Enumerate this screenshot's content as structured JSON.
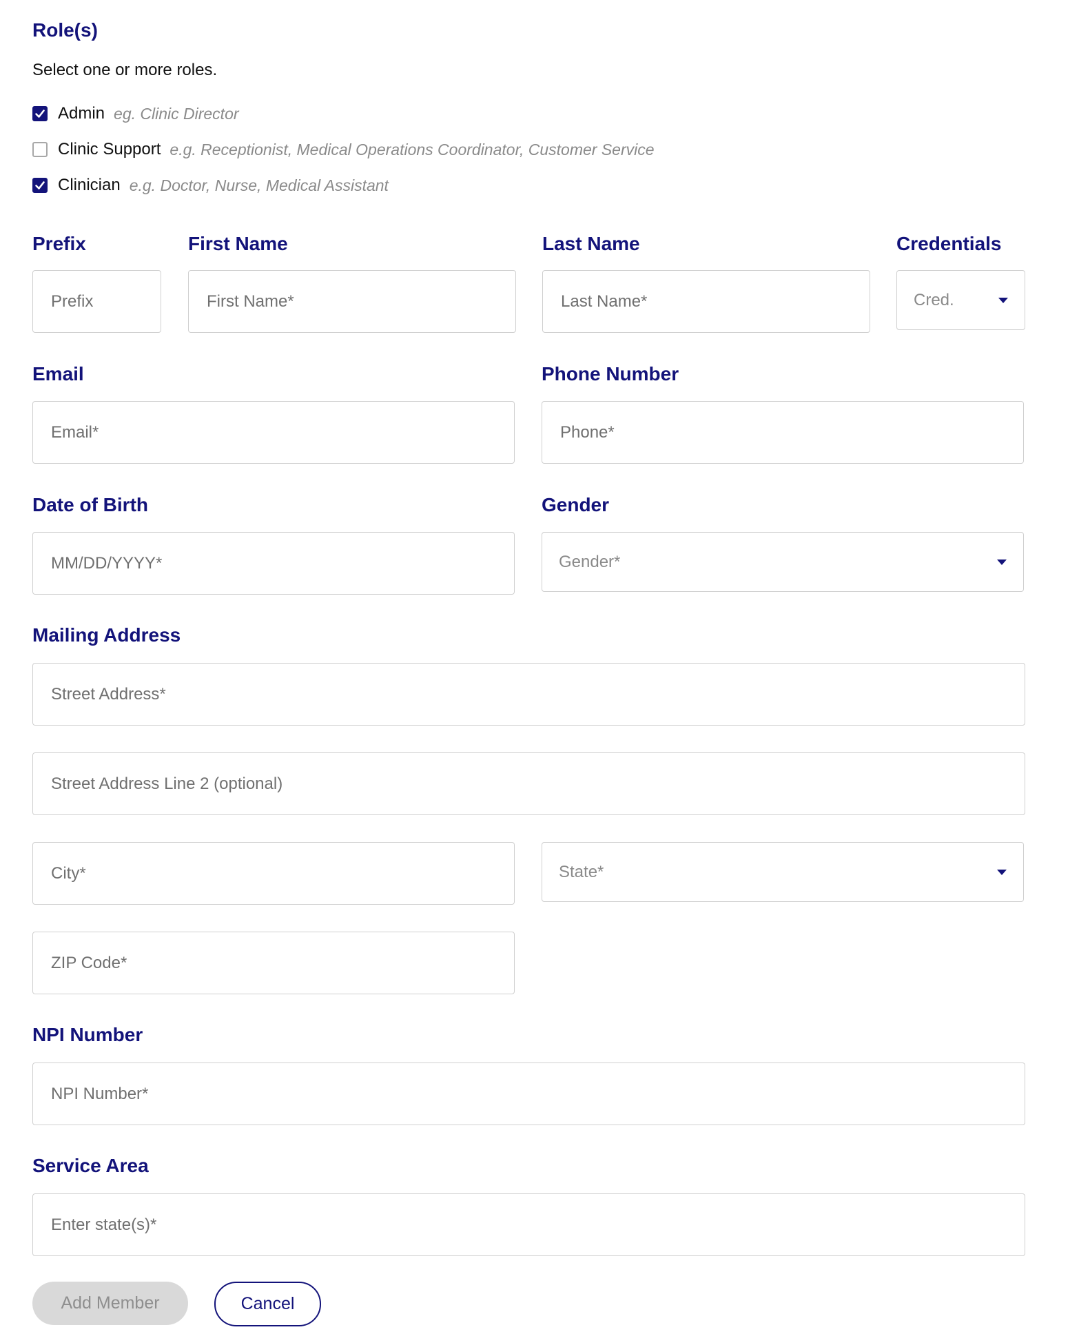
{
  "roles": {
    "heading": "Role(s)",
    "instruction": "Select one or more roles.",
    "options": [
      {
        "label": "Admin",
        "example": "eg. Clinic Director",
        "checked": true
      },
      {
        "label": "Clinic Support",
        "example": "e.g. Receptionist, Medical Operations Coordinator, Customer Service",
        "checked": false
      },
      {
        "label": "Clinician",
        "example": "e.g. Doctor, Nurse, Medical Assistant",
        "checked": true
      }
    ]
  },
  "name": {
    "prefix": {
      "heading": "Prefix",
      "placeholder": "Prefix"
    },
    "first": {
      "heading": "First Name",
      "placeholder": "First Name*"
    },
    "last": {
      "heading": "Last Name",
      "placeholder": "Last Name*"
    },
    "credentials": {
      "heading": "Credentials",
      "placeholder": "Cred."
    }
  },
  "contact": {
    "email": {
      "heading": "Email",
      "placeholder": "Email*"
    },
    "phone": {
      "heading": "Phone Number",
      "placeholder": "Phone*"
    }
  },
  "personal": {
    "dob": {
      "heading": "Date of Birth",
      "placeholder": "MM/DD/YYYY*"
    },
    "gender": {
      "heading": "Gender",
      "placeholder": "Gender*"
    }
  },
  "address": {
    "heading": "Mailing Address",
    "street1_placeholder": "Street Address*",
    "street2_placeholder": "Street Address Line 2 (optional)",
    "city_placeholder": "City*",
    "state_placeholder": "State*",
    "zip_placeholder": "ZIP Code*"
  },
  "npi": {
    "heading": "NPI Number",
    "placeholder": "NPI Number*"
  },
  "service_area": {
    "heading": "Service Area",
    "placeholder": "Enter state(s)*"
  },
  "actions": {
    "add_label": "Add Member",
    "cancel_label": "Cancel"
  },
  "colors": {
    "accent": "#13137a",
    "disabled_bg": "#d9d9d9",
    "border": "#cfcfcf"
  }
}
